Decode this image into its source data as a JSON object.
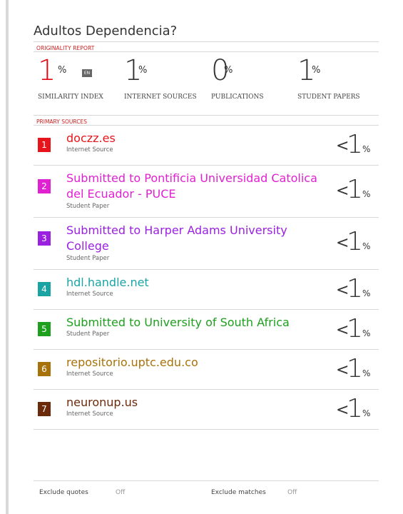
{
  "report": {
    "title": "Adultos Dependencia?",
    "originality_label": "ORIGINALITY REPORT",
    "primary_sources_label": "PRIMARY SOURCES"
  },
  "stats": {
    "similarity": {
      "value": "1",
      "unit": "%",
      "badge": "EN",
      "caption": "SIMILARITY INDEX"
    },
    "internet": {
      "value": "1",
      "unit": "%",
      "caption": "INTERNET SOURCES"
    },
    "publications": {
      "value": "0",
      "unit": "%",
      "caption": "PUBLICATIONS"
    },
    "student": {
      "value": "1",
      "unit": "%",
      "caption": "STUDENT PAPERS"
    }
  },
  "sources": [
    {
      "num": "1",
      "name_lines": [
        "doczz.es"
      ],
      "type": "Internet Source",
      "color": "#e8141b",
      "lt": "<",
      "value": "1",
      "unit": "%"
    },
    {
      "num": "2",
      "name_lines": [
        "Submitted to Pontificia Universidad Catolica",
        "del Ecuador - PUCE"
      ],
      "type": "Student Paper",
      "color": "#e021d2",
      "lt": "<",
      "value": "1",
      "unit": "%"
    },
    {
      "num": "3",
      "name_lines": [
        "Submitted to Harper Adams University",
        "College"
      ],
      "type": "Student Paper",
      "color": "#9b21e0",
      "lt": "<",
      "value": "1",
      "unit": "%"
    },
    {
      "num": "4",
      "name_lines": [
        "hdl.handle.net"
      ],
      "type": "Internet Source",
      "color": "#1aa3a3",
      "lt": "<",
      "value": "1",
      "unit": "%"
    },
    {
      "num": "5",
      "name_lines": [
        "Submitted to University of South Africa"
      ],
      "type": "Student Paper",
      "color": "#1ea01e",
      "lt": "<",
      "value": "1",
      "unit": "%"
    },
    {
      "num": "6",
      "name_lines": [
        "repositorio.uptc.edu.co"
      ],
      "type": "Internet Source",
      "color": "#a8720a",
      "lt": "<",
      "value": "1",
      "unit": "%"
    },
    {
      "num": "7",
      "name_lines": [
        "neuronup.us"
      ],
      "type": "Internet Source",
      "color": "#6b2a0a",
      "lt": "<",
      "value": "1",
      "unit": "%"
    }
  ],
  "footer": {
    "exclude_quotes_label": "Exclude quotes",
    "exclude_quotes_value": "Off",
    "exclude_matches_label": "Exclude matches",
    "exclude_matches_value": "Off"
  }
}
